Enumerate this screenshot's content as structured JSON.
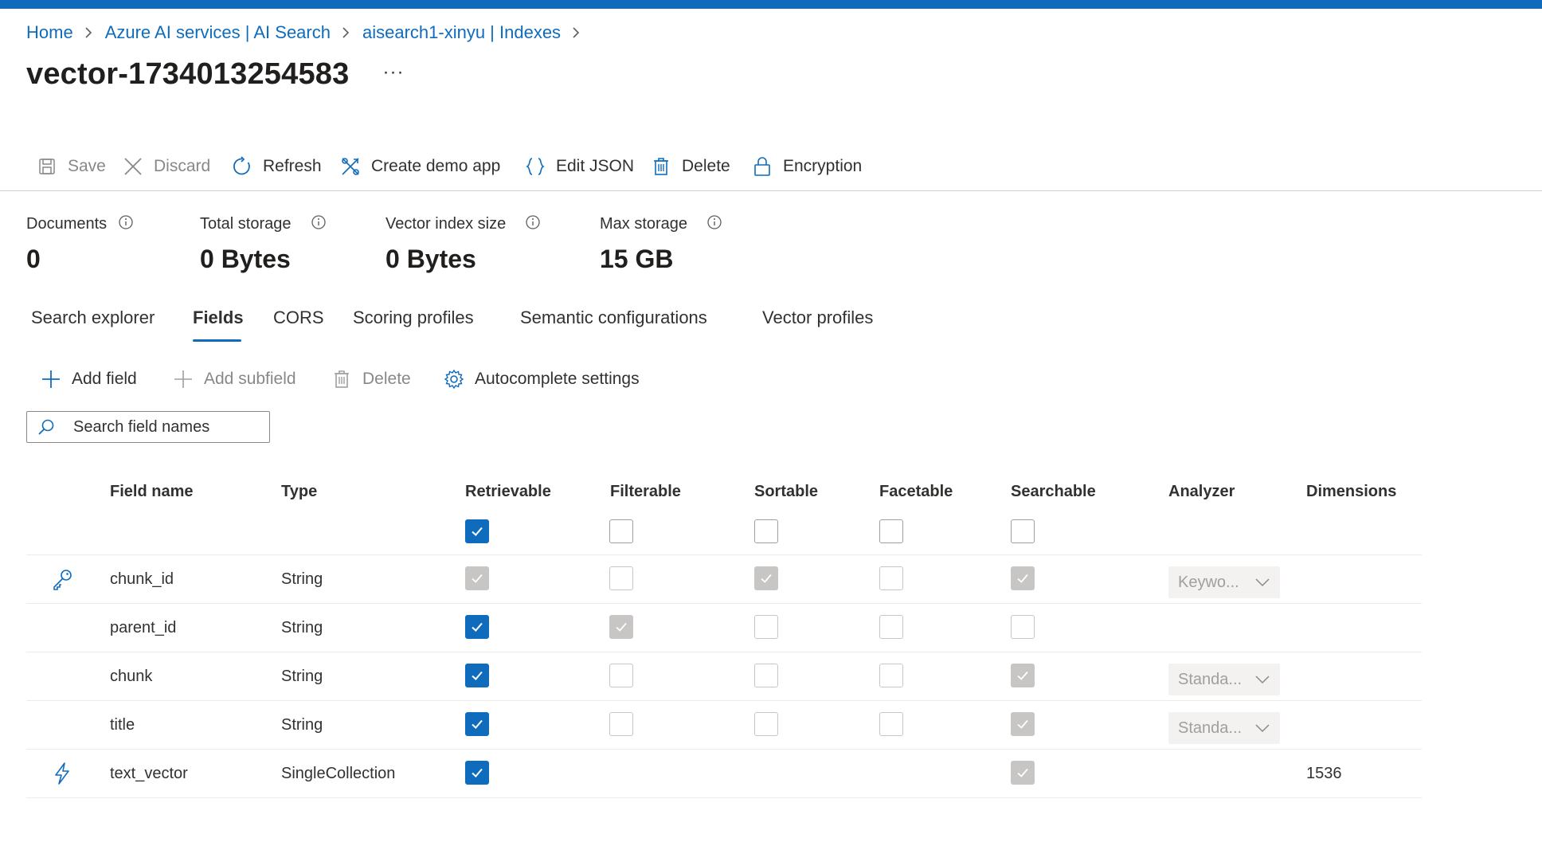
{
  "breadcrumb": [
    "Home",
    "Azure AI services | AI Search",
    "aisearch1-xinyu | Indexes"
  ],
  "page_title": "vector-1734013254583",
  "more_label": "···",
  "toolbar": {
    "save": "Save",
    "discard": "Discard",
    "refresh": "Refresh",
    "create_demo_app": "Create demo app",
    "edit_json": "Edit JSON",
    "delete": "Delete",
    "encryption": "Encryption"
  },
  "stats": [
    {
      "label": "Documents",
      "value": "0"
    },
    {
      "label": "Total storage",
      "value": "0 Bytes"
    },
    {
      "label": "Vector index size",
      "value": "0 Bytes"
    },
    {
      "label": "Max storage",
      "value": "15 GB"
    }
  ],
  "tabs": [
    "Search explorer",
    "Fields",
    "CORS",
    "Scoring profiles",
    "Semantic configurations",
    "Vector profiles"
  ],
  "active_tab": "Fields",
  "field_toolbar": {
    "add_field": "Add field",
    "add_subfield": "Add subfield",
    "delete": "Delete",
    "autocomplete": "Autocomplete settings"
  },
  "search": {
    "placeholder": "Search field names"
  },
  "columns": [
    "Field name",
    "Type",
    "Retrievable",
    "Filterable",
    "Sortable",
    "Facetable",
    "Searchable",
    "Analyzer",
    "Dimensions"
  ],
  "header_checks": {
    "retrievable": "on",
    "filterable": "off",
    "sortable": "off",
    "facetable": "off",
    "searchable": "off"
  },
  "rows": [
    {
      "icon": "key-icon",
      "name": "chunk_id",
      "type": "String",
      "retrievable": "dis-on",
      "filterable": "dis-off",
      "sortable": "dis-on",
      "facetable": "dis-off",
      "searchable": "dis-on",
      "analyzer": "Keywo...",
      "dimensions": ""
    },
    {
      "icon": "",
      "name": "parent_id",
      "type": "String",
      "retrievable": "on",
      "filterable": "dis-on",
      "sortable": "dis-off",
      "facetable": "dis-off",
      "searchable": "dis-off",
      "analyzer": "",
      "dimensions": ""
    },
    {
      "icon": "",
      "name": "chunk",
      "type": "String",
      "retrievable": "on",
      "filterable": "dis-off",
      "sortable": "dis-off",
      "facetable": "dis-off",
      "searchable": "dis-on",
      "analyzer": "Standa...",
      "dimensions": ""
    },
    {
      "icon": "",
      "name": "title",
      "type": "String",
      "retrievable": "on",
      "filterable": "dis-off",
      "sortable": "dis-off",
      "facetable": "dis-off",
      "searchable": "dis-on",
      "analyzer": "Standa...",
      "dimensions": ""
    },
    {
      "icon": "lightning-icon",
      "name": "text_vector",
      "type": "SingleCollection",
      "retrievable": "on",
      "filterable": "none",
      "sortable": "none",
      "facetable": "none",
      "searchable": "dis-on",
      "analyzer": "",
      "dimensions": "1536"
    }
  ],
  "colors": {
    "accent": "#0f6cbd",
    "disabled_check": "#c8c6c4",
    "text": "#323130"
  }
}
